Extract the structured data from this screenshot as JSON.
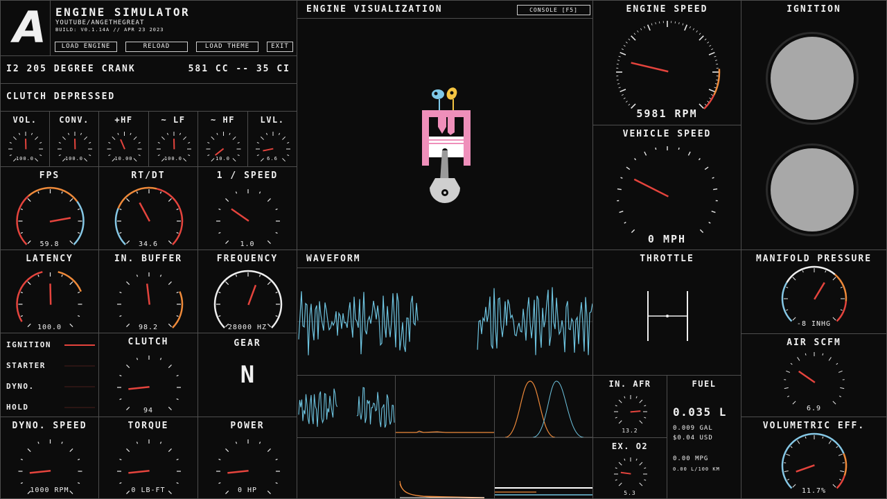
{
  "app": {
    "logo": "A",
    "title": "ENGINE SIMULATOR",
    "subtitle": "YOUTUBE/ANGETHEGREAT",
    "build": "BUILD: V0.1.14A // APR 23 2023",
    "buttons": {
      "load_engine": "LOAD ENGINE",
      "reload": "RELOAD",
      "load_theme": "LOAD THEME",
      "exit": "EXIT"
    },
    "engine_name": "I2 205 DEGREE CRANK",
    "displacement": "581 CC -- 35 CI",
    "status": "CLUTCH DEPRESSED"
  },
  "visualization": {
    "title": "ENGINE VISUALIZATION",
    "console_button": "CONSOLE [F5]"
  },
  "colors": {
    "accent_red": "#e5443d",
    "accent_orange": "#ef8a3a",
    "accent_blue": "#86c8e6",
    "wave_blue": "#6ec4e0",
    "ignition_grey": "#a8a8a8"
  },
  "gauges": [
    {
      "id": "vol",
      "label": "VOL.",
      "value": "100.0",
      "frac": 0.5,
      "scale": "small",
      "ticks": true
    },
    {
      "id": "conv",
      "label": "CONV.",
      "value": "100.0",
      "frac": 0.5,
      "scale": "small",
      "ticks": true
    },
    {
      "id": "hf",
      "label": "+HF",
      "value": "10.00",
      "frac": 0.42,
      "scale": "small",
      "ticks": true
    },
    {
      "id": "lf",
      "label": "~ LF",
      "value": "100.0",
      "frac": 0.5,
      "scale": "small",
      "ticks": true
    },
    {
      "id": "hf2",
      "label": "~ HF",
      "value": "10.0",
      "frac": 0.03,
      "scale": "small",
      "ticks": true
    },
    {
      "id": "lvl",
      "label": "LVL.",
      "value": "6.6",
      "frac": 0.13,
      "scale": "small",
      "ticks": true
    },
    {
      "id": "fps",
      "label": "FPS",
      "value": "59.8",
      "frac": 0.8,
      "scale": "medium",
      "bands": [
        [
          0,
          0.35,
          "red"
        ],
        [
          0.35,
          0.7,
          "orange"
        ],
        [
          0.7,
          1,
          "blue"
        ]
      ]
    },
    {
      "id": "rtdt",
      "label": "RT/DT",
      "value": "34.6",
      "frac": 0.4,
      "scale": "medium",
      "bands": [
        [
          0,
          0.25,
          "blue"
        ],
        [
          0.25,
          0.55,
          "orange"
        ],
        [
          0.55,
          1,
          "red"
        ]
      ]
    },
    {
      "id": "speed1",
      "label": "1 / SPEED",
      "value": "1.0",
      "frac": 0.3,
      "scale": "medium"
    },
    {
      "id": "latency",
      "label": "LATENCY",
      "value": "100.0",
      "frac": 0.5,
      "scale": "medium",
      "bands": [
        [
          0.05,
          0.25,
          "red"
        ],
        [
          0.25,
          0.45,
          "red"
        ],
        [
          0.55,
          0.75,
          "orange"
        ]
      ]
    },
    {
      "id": "inbuffer",
      "label": "IN. BUFFER",
      "value": "98.2",
      "frac": 0.48,
      "scale": "medium",
      "bands": [
        [
          0.75,
          1,
          "orange"
        ]
      ]
    },
    {
      "id": "frequency",
      "label": "FREQUENCY",
      "value": "28000 HZ",
      "frac": 0.58,
      "scale": "medium",
      "bands": [
        [
          0,
          1,
          "white"
        ]
      ]
    },
    {
      "id": "clutch",
      "label": "CLUTCH",
      "value": "94",
      "frac": 0.15,
      "scale": "medium"
    },
    {
      "id": "dyno",
      "label": "DYNO. SPEED",
      "value": "1000 RPM",
      "frac": 0.15,
      "scale": "medium"
    },
    {
      "id": "torque",
      "label": "TORQUE",
      "value": "0 LB-FT",
      "frac": 0.15,
      "scale": "medium"
    },
    {
      "id": "power",
      "label": "POWER",
      "value": "0 HP",
      "frac": 0.15,
      "scale": "medium"
    }
  ],
  "engine_speed": {
    "label": "ENGINE SPEED",
    "value": "5981 RPM",
    "frac": 0.22
  },
  "vehicle_speed": {
    "label": "VEHICLE SPEED",
    "value": "0 MPH",
    "frac": 0.27
  },
  "ignition": {
    "label": "IGNITION"
  },
  "status_list": {
    "items": [
      {
        "label": "IGNITION",
        "active": true
      },
      {
        "label": "STARTER",
        "active": false
      },
      {
        "label": "DYNO.",
        "active": false
      },
      {
        "label": "HOLD",
        "active": false
      }
    ]
  },
  "gear": {
    "label": "GEAR",
    "value": "N"
  },
  "waveform": {
    "label": "WAVEFORM"
  },
  "throttle": {
    "label": "THROTTLE"
  },
  "manifold": {
    "label": "MANIFOLD PRESSURE",
    "value": "-8 INHG",
    "frac": 0.62
  },
  "air_scfm": {
    "label": "AIR SCFM",
    "value": "6.9",
    "frac": 0.3
  },
  "volumetric": {
    "label": "VOLUMETRIC EFF.",
    "value": "11.7%",
    "frac": 0.1
  },
  "in_afr": {
    "label": "IN. AFR",
    "value": "13.2",
    "frac": 0.82
  },
  "ex_o2": {
    "label": "EX. O2",
    "value": "5.3",
    "frac": 0.2
  },
  "fuel": {
    "label": "FUEL",
    "volume": "0.035 L",
    "gal": "0.009 GAL",
    "usd": "$0.04 USD",
    "mpg": "0.00 MPG",
    "l100": "0.00 L/100 KM"
  }
}
